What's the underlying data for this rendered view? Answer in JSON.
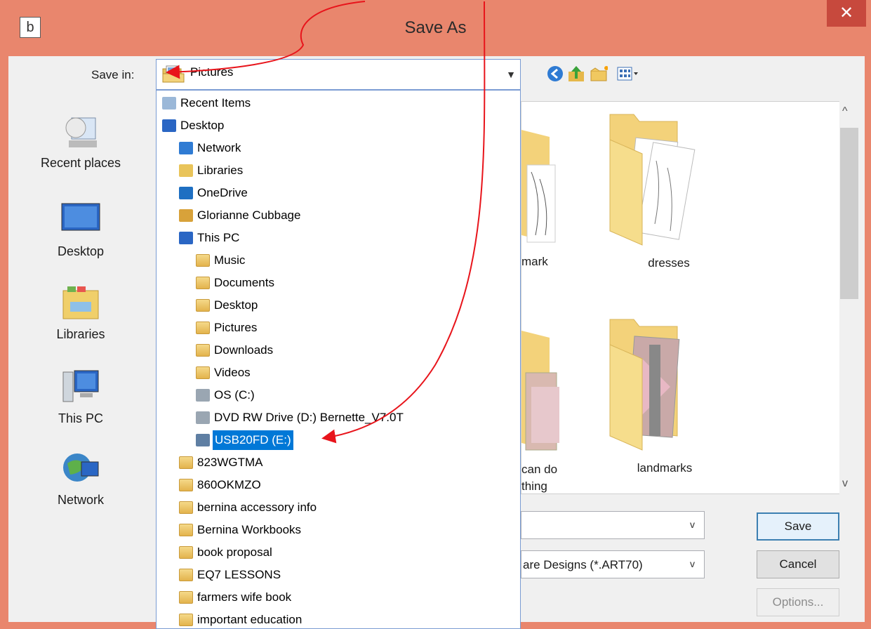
{
  "window": {
    "title": "Save As",
    "app_icon_letter": "b",
    "close_glyph": "✕"
  },
  "toolbar": {
    "save_in_label": "Save in:",
    "location_value": "Pictures",
    "icons": [
      "back-icon",
      "up-folder-icon",
      "new-folder-icon",
      "view-menu-icon"
    ]
  },
  "places": [
    {
      "label": "Recent places",
      "icon": "recent-places-icon"
    },
    {
      "label": "Desktop",
      "icon": "desktop-icon"
    },
    {
      "label": "Libraries",
      "icon": "libraries-icon"
    },
    {
      "label": "This PC",
      "icon": "this-pc-icon"
    },
    {
      "label": "Network",
      "icon": "network-icon"
    }
  ],
  "dropdown": {
    "items": [
      {
        "label": "Recent Items",
        "icon": "recent-items-icon",
        "indent": 0
      },
      {
        "label": "Desktop",
        "icon": "desktop-icon",
        "indent": 0
      },
      {
        "label": "Network",
        "icon": "network-icon",
        "indent": 1
      },
      {
        "label": "Libraries",
        "icon": "libraries-icon",
        "indent": 1
      },
      {
        "label": "OneDrive",
        "icon": "onedrive-icon",
        "indent": 1
      },
      {
        "label": "Glorianne Cubbage",
        "icon": "user-icon",
        "indent": 1
      },
      {
        "label": "This PC",
        "icon": "this-pc-icon",
        "indent": 1
      },
      {
        "label": "Music",
        "icon": "music-folder-icon",
        "indent": 2
      },
      {
        "label": "Documents",
        "icon": "documents-folder-icon",
        "indent": 2
      },
      {
        "label": "Desktop",
        "icon": "desktop-folder-icon",
        "indent": 2
      },
      {
        "label": "Pictures",
        "icon": "pictures-folder-icon",
        "indent": 2
      },
      {
        "label": "Downloads",
        "icon": "downloads-folder-icon",
        "indent": 2
      },
      {
        "label": "Videos",
        "icon": "videos-folder-icon",
        "indent": 2
      },
      {
        "label": "OS (C:)",
        "icon": "drive-icon",
        "indent": 2
      },
      {
        "label": "DVD RW Drive (D:) Bernette_V7.0T",
        "icon": "dvd-drive-icon",
        "indent": 2
      },
      {
        "label": "USB20FD (E:)",
        "icon": "usb-drive-icon",
        "indent": 2,
        "selected": true
      },
      {
        "label": "823WGTMA",
        "icon": "folder-icon",
        "indent": 1
      },
      {
        "label": "860OKMZO",
        "icon": "folder-icon",
        "indent": 1
      },
      {
        "label": "bernina accessory info",
        "icon": "folder-icon",
        "indent": 1
      },
      {
        "label": "Bernina Workbooks",
        "icon": "folder-icon",
        "indent": 1
      },
      {
        "label": "book proposal",
        "icon": "folder-icon",
        "indent": 1
      },
      {
        "label": "EQ7 LESSONS",
        "icon": "folder-icon",
        "indent": 1
      },
      {
        "label": "farmers wife book",
        "icon": "folder-icon",
        "indent": 1
      },
      {
        "label": "important education",
        "icon": "folder-icon",
        "indent": 1
      }
    ]
  },
  "files": {
    "partial_captions": [
      "mark",
      "can do",
      "thing"
    ],
    "folders": [
      "dresses",
      "landmarks"
    ]
  },
  "form": {
    "filetype_partial": "are Designs (*.ART70)"
  },
  "buttons": {
    "save": "Save",
    "cancel": "Cancel",
    "options": "Options..."
  },
  "colors": {
    "title_bar": "#e9866d",
    "close_button": "#c7493d",
    "selection": "#0078d7",
    "annotation_arrow": "#e8141b"
  }
}
